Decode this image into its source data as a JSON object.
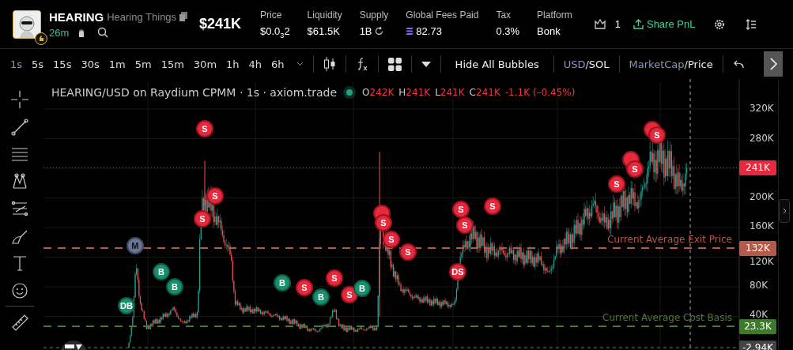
{
  "token": {
    "symbol": "HEARING",
    "name": "Hearing Things",
    "age": "26m"
  },
  "market_cap": "$241K",
  "stats": [
    {
      "kind": "plain",
      "label": "Price",
      "value": "$0.0$_{3}$2"
    },
    {
      "kind": "plain",
      "label": "Liquidity",
      "value": "$61.5K"
    },
    {
      "kind": "refresh",
      "label": "Supply",
      "value": "1B"
    },
    {
      "kind": "sol",
      "label": "Global Fees Paid",
      "value": "82.73"
    },
    {
      "kind": "plain",
      "label": "Tax",
      "value": "0.3%"
    },
    {
      "kind": "plain",
      "label": "Platform",
      "value": "Bonk"
    }
  ],
  "crown_count": "1",
  "share_button": "Share PnL",
  "timeframes": [
    {
      "label": "1s",
      "selected": true
    },
    {
      "label": "5s",
      "selected": false
    },
    {
      "label": "15s",
      "selected": false
    },
    {
      "label": "30s",
      "selected": false
    },
    {
      "label": "1m",
      "selected": false
    },
    {
      "label": "5m",
      "selected": false
    },
    {
      "label": "15m",
      "selected": false
    },
    {
      "label": "30m",
      "selected": false
    },
    {
      "label": "1h",
      "selected": false
    },
    {
      "label": "4h",
      "selected": false
    },
    {
      "label": "6h",
      "selected": false
    }
  ],
  "hide_bubbles_button": "Hide All Bubbles",
  "currency_toggle": {
    "separator": "/",
    "options": [
      {
        "label": "USD",
        "selected": true
      },
      {
        "label": "SOL",
        "selected": false
      }
    ]
  },
  "value_toggle": {
    "separator": "/",
    "options": [
      {
        "label": "MarketCap",
        "selected": true
      },
      {
        "label": "Price",
        "selected": false
      }
    ]
  },
  "chart": {
    "legend": "HEARING/USD on Raydium CPMM · 1s · axiom.trade",
    "ohlc": [
      {
        "key": "O",
        "value": "242K"
      },
      {
        "key": "H",
        "value": "241K"
      },
      {
        "key": "L",
        "value": "241K"
      },
      {
        "key": "C",
        "value": "241K"
      }
    ],
    "change": "-1.1K (–0.45%)",
    "y_labels": [
      "320K",
      "280K",
      "200K",
      "160K",
      "120K",
      "80K",
      "40K"
    ],
    "price_lines": [
      {
        "kind": "last",
        "value": "241K"
      },
      {
        "kind": "exit",
        "label": "Current Average Exit Price",
        "value": "132K"
      },
      {
        "kind": "cost",
        "label": "Current Average Cost Basis",
        "value": "23.3K"
      },
      {
        "kind": "cursor",
        "value": "-2.94K"
      }
    ],
    "bubbles": [
      {
        "kind": "sell",
        "text": "S"
      },
      {
        "kind": "sell",
        "text": "S"
      },
      {
        "kind": "sell",
        "text": "S"
      },
      {
        "kind": "migration",
        "text": "M"
      },
      {
        "kind": "buy",
        "text": "B"
      },
      {
        "kind": "buy",
        "text": "B"
      },
      {
        "kind": "buy",
        "text": "DB"
      },
      {
        "kind": "buy",
        "text": "B"
      },
      {
        "kind": "sell",
        "text": "S"
      },
      {
        "kind": "buy",
        "text": "B"
      },
      {
        "kind": "sell",
        "text": "S"
      },
      {
        "kind": "sell",
        "text": "S"
      },
      {
        "kind": "buy",
        "text": "B"
      },
      {
        "kind": "sell"
      },
      {
        "kind": "sell",
        "text": "S"
      },
      {
        "kind": "sell",
        "text": "S"
      },
      {
        "kind": "sell",
        "text": "S"
      },
      {
        "kind": "sell",
        "text": "S"
      },
      {
        "kind": "sell",
        "text": "S"
      },
      {
        "kind": "sell",
        "text": "DS"
      },
      {
        "kind": "sell",
        "text": "S"
      },
      {
        "kind": "sell",
        "text": "S"
      },
      {
        "kind": "sell"
      },
      {
        "kind": "sell",
        "text": "S"
      },
      {
        "kind": "sell"
      },
      {
        "kind": "sell",
        "text": "S"
      }
    ]
  }
}
